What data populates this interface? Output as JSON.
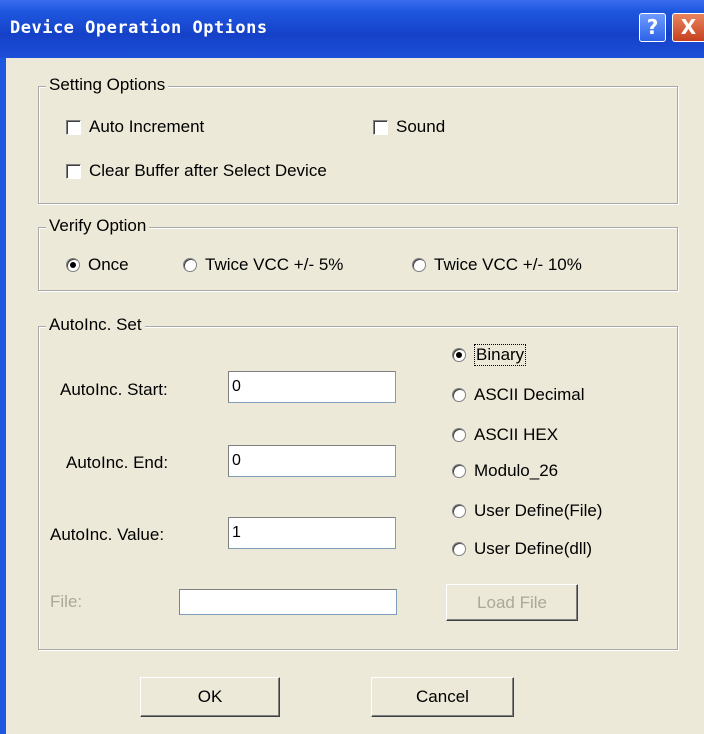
{
  "window": {
    "title": "Device Operation Options",
    "help_glyph": "?",
    "close_glyph": "X"
  },
  "setting_options": {
    "title": "Setting Options",
    "auto_increment": {
      "label": "Auto Increment",
      "checked": false
    },
    "sound": {
      "label": "Sound",
      "checked": false
    },
    "clear_buffer": {
      "label": "Clear Buffer after Select Device",
      "checked": false
    }
  },
  "verify_option": {
    "title": "Verify Option",
    "options": [
      {
        "label": "Once",
        "selected": true
      },
      {
        "label": "Twice VCC +/- 5%",
        "selected": false
      },
      {
        "label": "Twice VCC +/- 10%",
        "selected": false
      }
    ]
  },
  "autoinc_set": {
    "title": "AutoInc. Set",
    "start_label": "AutoInc. Start:",
    "start_value": "0",
    "end_label": "AutoInc. End:",
    "end_value": "0",
    "value_label": "AutoInc. Value:",
    "value_value": "1",
    "file_label": "File:",
    "file_value": "",
    "load_file_label": "Load File",
    "formats": [
      {
        "label": "Binary",
        "selected": true
      },
      {
        "label": "ASCII Decimal",
        "selected": false
      },
      {
        "label": "ASCII HEX",
        "selected": false
      },
      {
        "label": "Modulo_26",
        "selected": false
      },
      {
        "label": "User Define(File)",
        "selected": false
      },
      {
        "label": "User Define(dll)",
        "selected": false
      }
    ]
  },
  "buttons": {
    "ok": "OK",
    "cancel": "Cancel"
  }
}
